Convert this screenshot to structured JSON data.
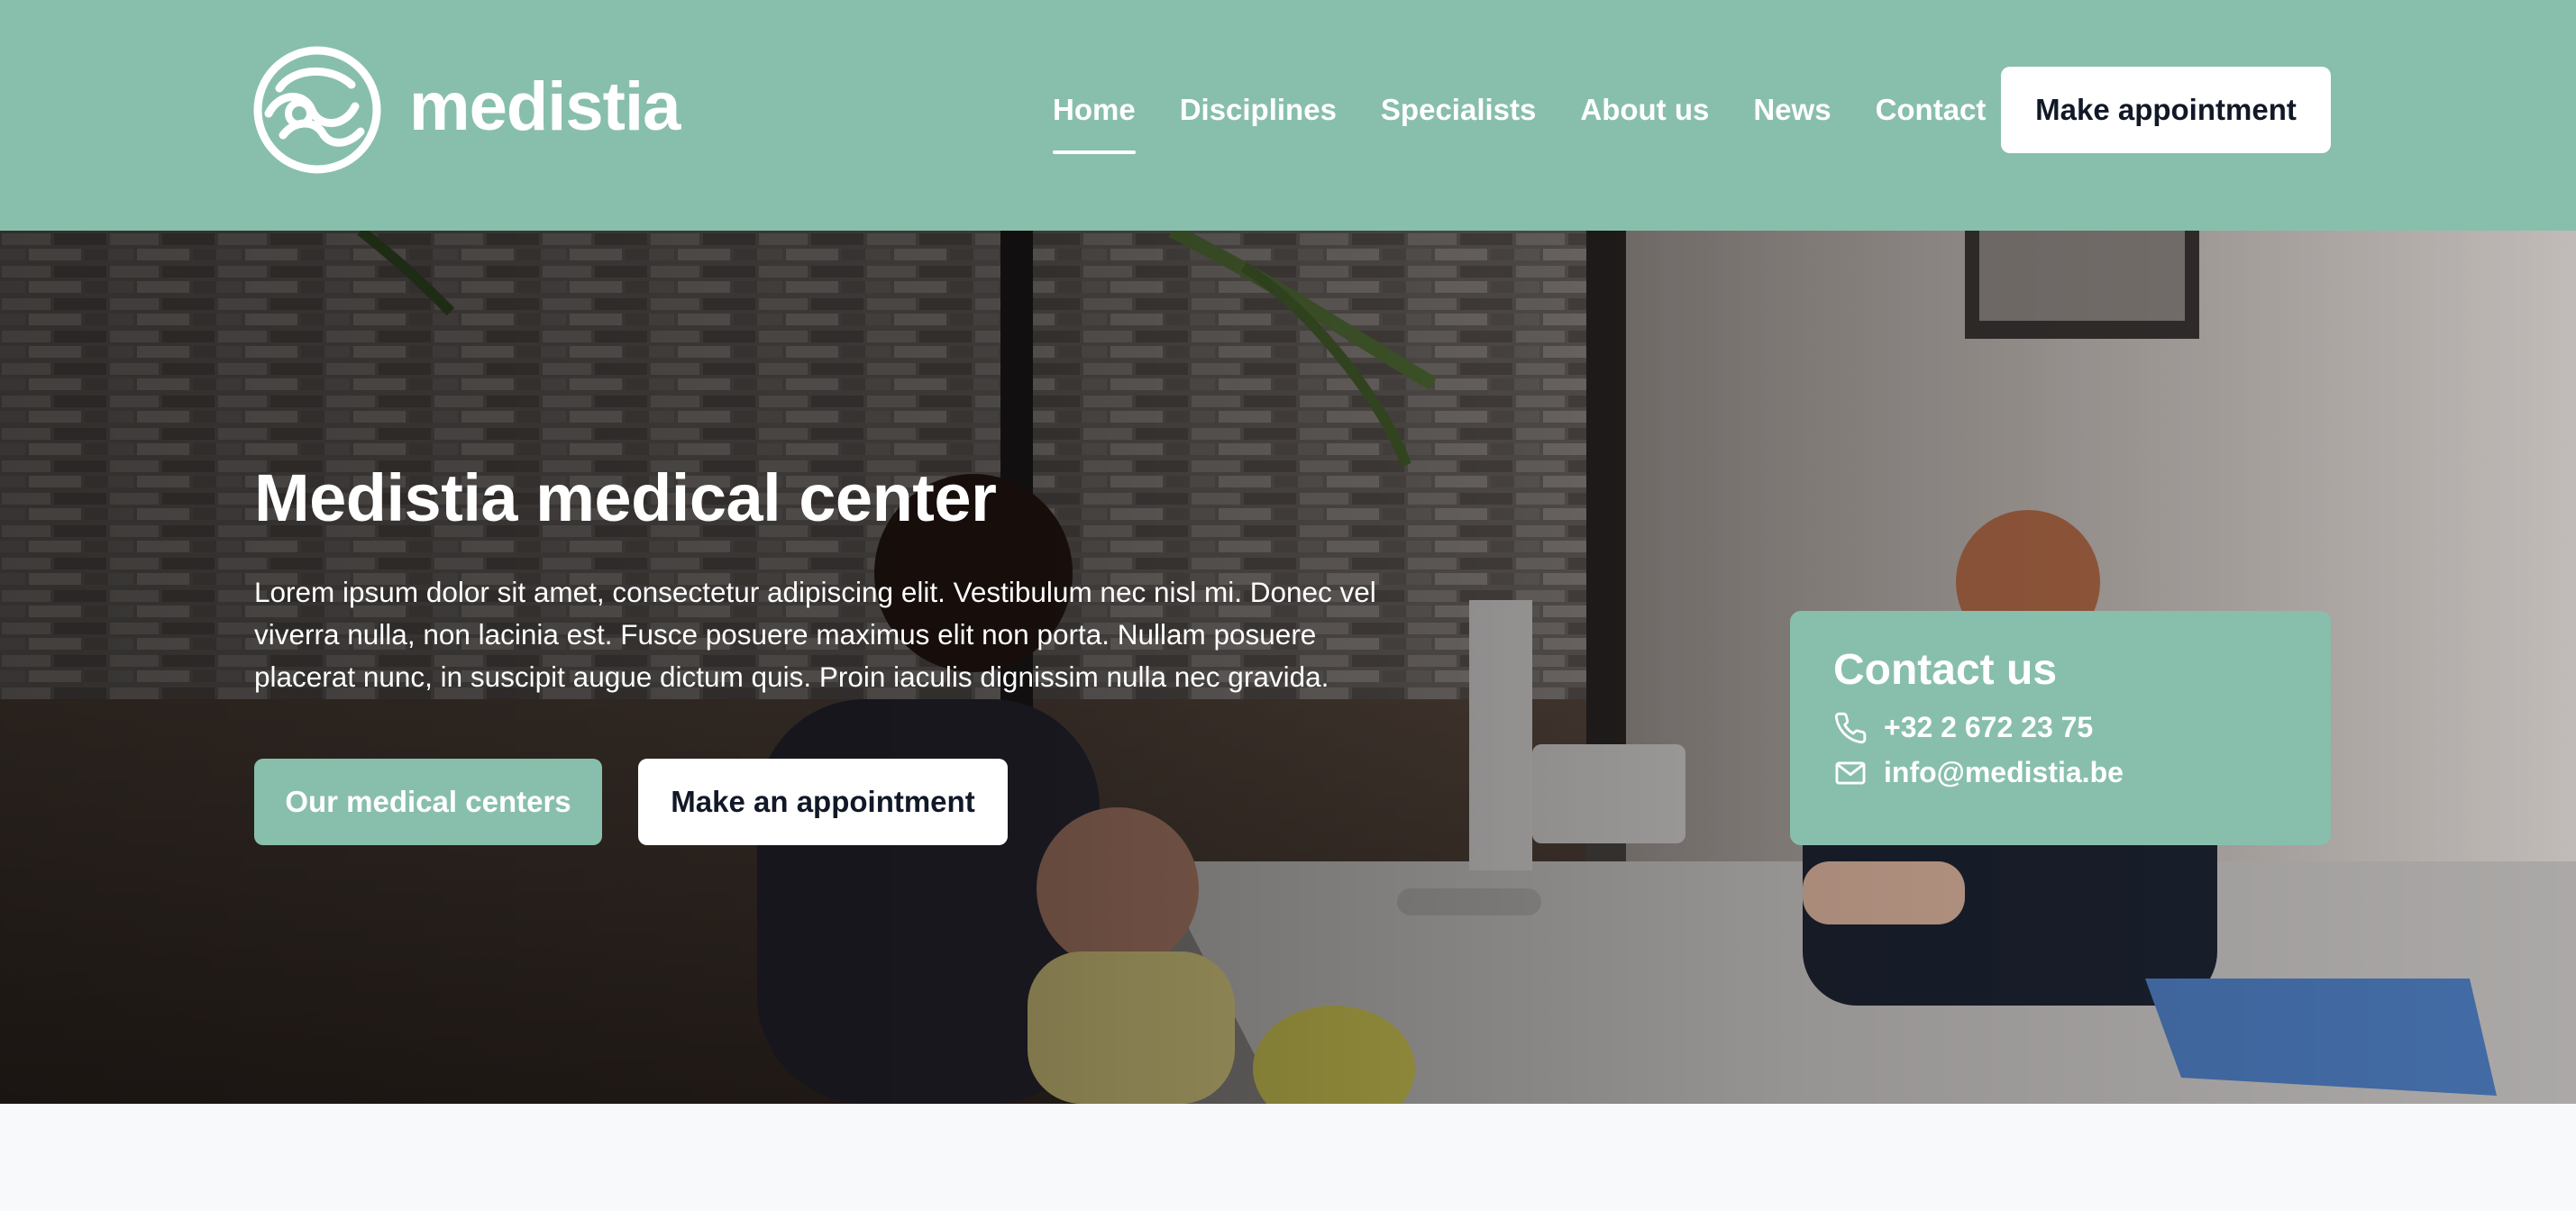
{
  "brand": {
    "name": "medistia",
    "logo_icon": "medistia-wave-logo-icon",
    "color": "#88bfac"
  },
  "nav": {
    "items": [
      {
        "label": "Home",
        "active": true
      },
      {
        "label": "Disciplines",
        "active": false
      },
      {
        "label": "Specialists",
        "active": false
      },
      {
        "label": "About us",
        "active": false
      },
      {
        "label": "News",
        "active": false
      },
      {
        "label": "Contact",
        "active": false
      }
    ],
    "cta_label": "Make appointment"
  },
  "hero": {
    "title": "Medistia medical center",
    "text": "Lorem ipsum dolor sit amet, consectetur adipiscing elit. Vestibulum nec nisl mi. Donec vel viverra nulla, non lacinia est. Fusce posuere maximus elit non porta. Nullam posuere placerat nunc, in suscipit augue dictum quis. Proin iaculis dignissim nulla nec gravida.",
    "primary_button": "Our medical centers",
    "secondary_button": "Make an appointment"
  },
  "contact": {
    "title": "Contact us",
    "phone": "+32 2 672 23 75",
    "phone_icon": "phone-icon",
    "email": "info@medistia.be",
    "email_icon": "mail-icon"
  }
}
